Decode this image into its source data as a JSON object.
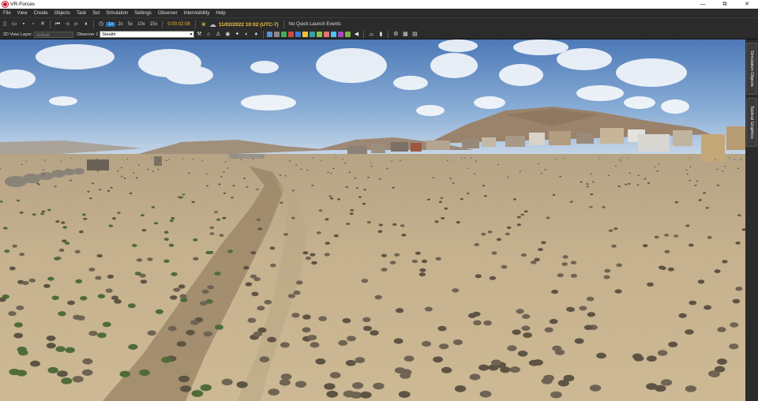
{
  "window": {
    "title": "VR-Forces",
    "controls": {
      "minimize": "—",
      "maximize": "⧉",
      "close": "✕"
    }
  },
  "menu": [
    "File",
    "View",
    "Create",
    "Objects",
    "Task",
    "Set",
    "Simulation",
    "Settings",
    "Observer",
    "Intervisibility",
    "Help"
  ],
  "toolbar": {
    "speeds": [
      "1x",
      "2x",
      "5x",
      "10x",
      "15x"
    ],
    "active_speed": "1x",
    "sim_time": "0:00:02:08",
    "date": "11/02/2022 10:02 (UTC-7)",
    "events": "No Quick Launch Events"
  },
  "viewbar": {
    "view_layer_label": "2D View Layer:",
    "view_layer_value": "default",
    "observer_label": "Observer 1",
    "observer_value": "Stealth"
  },
  "side_tabs": [
    "Simulation Objects",
    "Tactical Graphics"
  ],
  "colors": {
    "accent": "#1e6fb8",
    "toolbar_bg": "#2b2b2b",
    "sky_top": "#4d79b8",
    "sky_horizon": "#c9d8e8",
    "ground": "#c8b48e",
    "date_text": "#f2c64a"
  }
}
